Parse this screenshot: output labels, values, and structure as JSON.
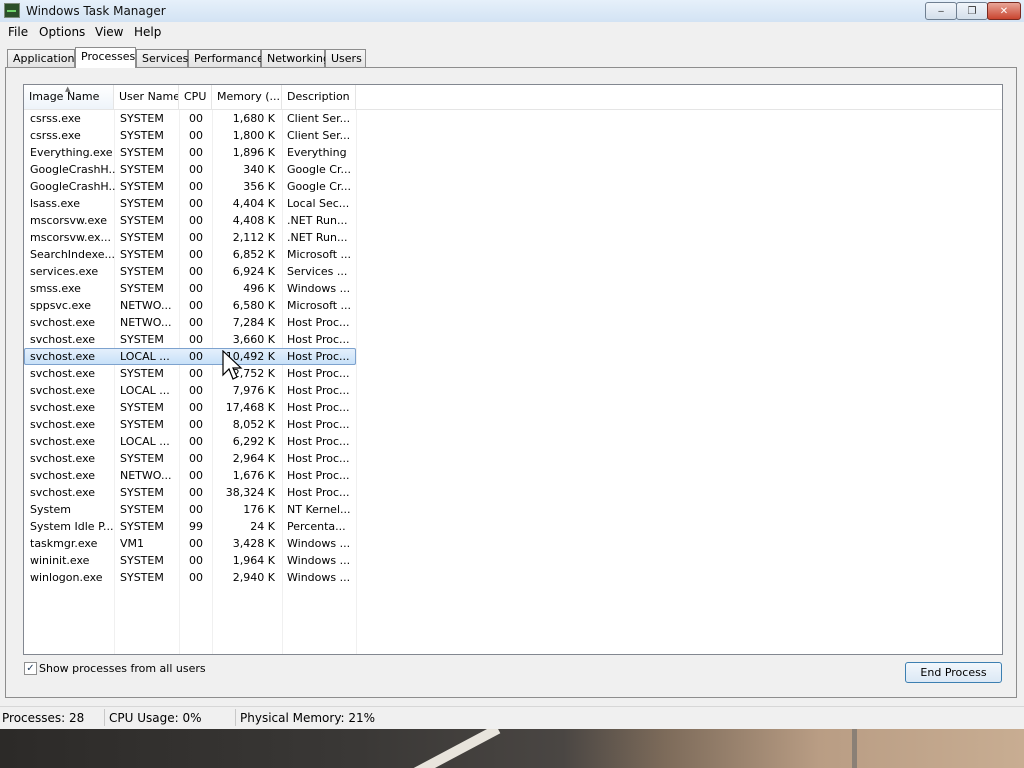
{
  "window": {
    "title": "Windows Task Manager"
  },
  "menu": [
    "File",
    "Options",
    "View",
    "Help"
  ],
  "tabs": [
    "Applications",
    "Processes",
    "Services",
    "Performance",
    "Networking",
    "Users"
  ],
  "active_tab": "Processes",
  "table": {
    "columns": [
      "Image Name",
      "User Name",
      "CPU",
      "Memory (...",
      "Description"
    ],
    "rows": [
      {
        "name": "csrss.exe",
        "user": "SYSTEM",
        "cpu": "00",
        "mem": "1,680 K",
        "desc": "Client Ser..."
      },
      {
        "name": "csrss.exe",
        "user": "SYSTEM",
        "cpu": "00",
        "mem": "1,800 K",
        "desc": "Client Ser..."
      },
      {
        "name": "Everything.exe",
        "user": "SYSTEM",
        "cpu": "00",
        "mem": "1,896 K",
        "desc": "Everything"
      },
      {
        "name": "GoogleCrashH...",
        "user": "SYSTEM",
        "cpu": "00",
        "mem": "340 K",
        "desc": "Google Cr..."
      },
      {
        "name": "GoogleCrashH...",
        "user": "SYSTEM",
        "cpu": "00",
        "mem": "356 K",
        "desc": "Google Cr..."
      },
      {
        "name": "lsass.exe",
        "user": "SYSTEM",
        "cpu": "00",
        "mem": "4,404 K",
        "desc": "Local Sec..."
      },
      {
        "name": "mscorsvw.exe",
        "user": "SYSTEM",
        "cpu": "00",
        "mem": "4,408 K",
        "desc": ".NET Run..."
      },
      {
        "name": "mscorsvw.ex...",
        "user": "SYSTEM",
        "cpu": "00",
        "mem": "2,112 K",
        "desc": ".NET Run..."
      },
      {
        "name": "SearchIndexe...",
        "user": "SYSTEM",
        "cpu": "00",
        "mem": "6,852 K",
        "desc": "Microsoft ..."
      },
      {
        "name": "services.exe",
        "user": "SYSTEM",
        "cpu": "00",
        "mem": "6,924 K",
        "desc": "Services ..."
      },
      {
        "name": "smss.exe",
        "user": "SYSTEM",
        "cpu": "00",
        "mem": "496 K",
        "desc": "Windows ..."
      },
      {
        "name": "sppsvc.exe",
        "user": "NETWO...",
        "cpu": "00",
        "mem": "6,580 K",
        "desc": "Microsoft ..."
      },
      {
        "name": "svchost.exe",
        "user": "NETWO...",
        "cpu": "00",
        "mem": "7,284 K",
        "desc": "Host Proc..."
      },
      {
        "name": "svchost.exe",
        "user": "SYSTEM",
        "cpu": "00",
        "mem": "3,660 K",
        "desc": "Host Proc..."
      },
      {
        "name": "svchost.exe",
        "user": "LOCAL ...",
        "cpu": "00",
        "mem": "10,492 K",
        "desc": "Host Proc...",
        "selected": true
      },
      {
        "name": "svchost.exe",
        "user": "SYSTEM",
        "cpu": "00",
        "mem": "2,752 K",
        "desc": "Host Proc..."
      },
      {
        "name": "svchost.exe",
        "user": "LOCAL ...",
        "cpu": "00",
        "mem": "7,976 K",
        "desc": "Host Proc..."
      },
      {
        "name": "svchost.exe",
        "user": "SYSTEM",
        "cpu": "00",
        "mem": "17,468 K",
        "desc": "Host Proc..."
      },
      {
        "name": "svchost.exe",
        "user": "SYSTEM",
        "cpu": "00",
        "mem": "8,052 K",
        "desc": "Host Proc..."
      },
      {
        "name": "svchost.exe",
        "user": "LOCAL ...",
        "cpu": "00",
        "mem": "6,292 K",
        "desc": "Host Proc..."
      },
      {
        "name": "svchost.exe",
        "user": "SYSTEM",
        "cpu": "00",
        "mem": "2,964 K",
        "desc": "Host Proc..."
      },
      {
        "name": "svchost.exe",
        "user": "NETWO...",
        "cpu": "00",
        "mem": "1,676 K",
        "desc": "Host Proc..."
      },
      {
        "name": "svchost.exe",
        "user": "SYSTEM",
        "cpu": "00",
        "mem": "38,324 K",
        "desc": "Host Proc..."
      },
      {
        "name": "System",
        "user": "SYSTEM",
        "cpu": "00",
        "mem": "176 K",
        "desc": "NT Kernel..."
      },
      {
        "name": "System Idle P...",
        "user": "SYSTEM",
        "cpu": "99",
        "mem": "24 K",
        "desc": "Percenta..."
      },
      {
        "name": "taskmgr.exe",
        "user": "VM1",
        "cpu": "00",
        "mem": "3,428 K",
        "desc": "Windows ..."
      },
      {
        "name": "wininit.exe",
        "user": "SYSTEM",
        "cpu": "00",
        "mem": "1,964 K",
        "desc": "Windows ..."
      },
      {
        "name": "winlogon.exe",
        "user": "SYSTEM",
        "cpu": "00",
        "mem": "2,940 K",
        "desc": "Windows ..."
      }
    ]
  },
  "show_all_users": {
    "label": "Show processes from all users",
    "checked": true
  },
  "end_process_label": "End Process",
  "status": {
    "processes": "Processes: 28",
    "cpu": "CPU Usage: 0%",
    "memory": "Physical Memory: 21%"
  },
  "icons": {
    "app": "task-manager-icon",
    "minimize": "minimize-icon",
    "maximize": "maximize-icon",
    "close": "close-icon",
    "cursor": "mouse-pointer-icon",
    "sort": "sort-ascending-icon"
  }
}
